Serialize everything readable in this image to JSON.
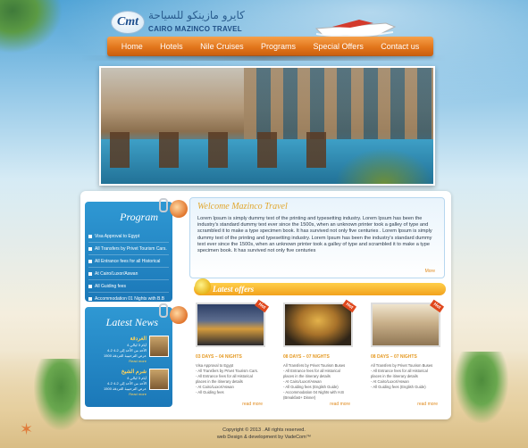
{
  "logo": {
    "badge": "Cmt",
    "arabic": "كايرو مازينكو للسياحة",
    "name": "CAIRO MAZINCO TRAVEL"
  },
  "nav": {
    "items": [
      "Home",
      "Hotels",
      "Nile Cruises",
      "Programs",
      "Special Offers",
      "Contact us"
    ]
  },
  "program": {
    "title": "Program",
    "items": [
      "Visa Approval to Egypt",
      "All Transfers by Privet Tourism Cars.",
      "All Entrance fees for all Historical",
      "At Cairo/Luxor/Aswan",
      "All Guiding fees",
      "Accommodation 01 Nights with B.B"
    ]
  },
  "news": {
    "title": "Latest News",
    "items": [
      {
        "title": "الغردقة",
        "lines": [
          "4 أيام 3 ليالي",
          "4-2 الأحد من الأحد إلى 2-4",
          "1500 عرض الترحيبية الغردقة"
        ],
        "more": "Read more"
      },
      {
        "title": "شرم الشيخ",
        "lines": [
          "4 أيام 3 ليالي",
          "4-2 الأحد من الأحد إلى 2-4",
          "1500 عرض الترحيبية الغردقة"
        ],
        "more": "Read more"
      }
    ]
  },
  "welcome": {
    "title": "Welcome Mazinco Travel",
    "body": "Lorem Ipsum is simply dummy text of the printing and typesetting industry. Lorem Ipsum has been the industry's standard dummy text ever since the 1500s, when an unknown printer took a galley of type and scrambled it to make a type specimen book. It has survived not only five centuries . Lorem Ipsum is simply dummy text of the printing and typesetting industry. Lorem Ipsum has been the industry's standard dummy text ever since the 1500s, when an unknown printer took a galley of type and scrambled it to make a type specimen book. It has survived not only five centuries",
    "more": "More"
  },
  "offers": {
    "title": "Latest offers",
    "cards": [
      {
        "ribbon": "Hot",
        "title": "03 DAYS – 04 NIGHTS",
        "lines": [
          "Visa Approval to Egypt",
          "- All Transfers by Privet Tourism Cars.",
          "- All Entrance fees for all Historical",
          "  places in the itinerary details",
          "- At Cairo/Luxor/Aswan",
          "- All Guiding fees"
        ],
        "more": "read more"
      },
      {
        "ribbon": "Hot",
        "title": "08 DAYS – 07 NIGHTS",
        "lines": [
          "All Transfers by Privet Tourism Buses",
          "- All Entrance fees for all Historical",
          "  places in the itinerary details",
          "- At Cairo/Luxor/Aswan",
          "- All Guiding fees (English Guide)",
          "- Accommodation 04 Nights with H.B",
          "  (Breakfast+ Dinner)"
        ],
        "more": "read more"
      },
      {
        "ribbon": "Hot",
        "title": "08 DAYS – 07 NIGHTS",
        "lines": [
          "All Transfers by Privet Tourism Buses",
          "- All Entrance fees for all Historical",
          "  places in the itinerary details",
          "- At Cairo/Luxor/Aswan",
          "- All Guiding fees (English Guide)"
        ],
        "more": "read more"
      }
    ]
  },
  "footer": {
    "copyright": "Copyright © 2013 . All rights reserved.",
    "credit": "web Design & development by VadeCom™"
  },
  "colors": {
    "nav_orange": "#e2751b",
    "panel_blue": "#1b78b8",
    "offer_gold": "#f2a21d",
    "title_gold": "#e1a62c"
  }
}
